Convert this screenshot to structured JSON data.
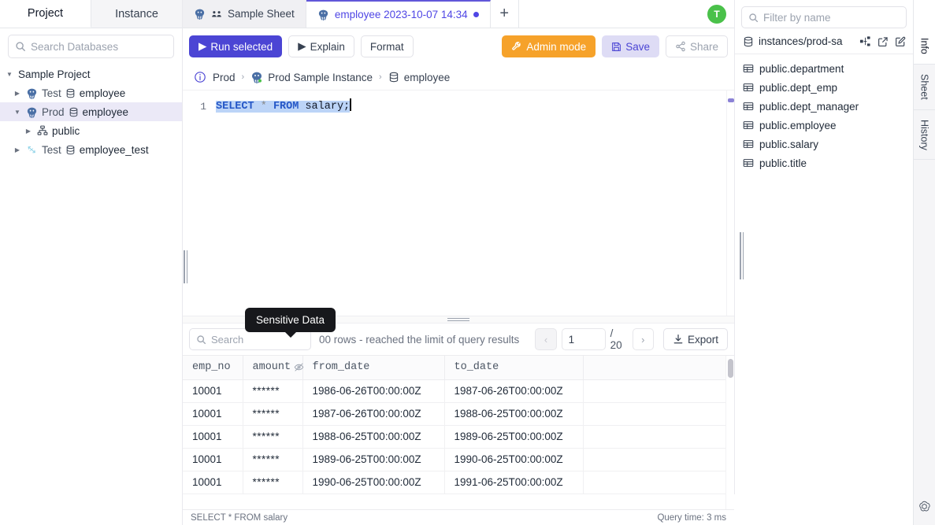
{
  "left_sidebar": {
    "tabs": [
      {
        "label": "Project",
        "active": true
      },
      {
        "label": "Instance",
        "active": false
      }
    ],
    "search": {
      "placeholder": "Search Databases",
      "value": ""
    },
    "tree": [
      {
        "label": "Sample Project",
        "icon": "none",
        "caret": "down",
        "level": 0,
        "selected": false
      },
      {
        "label_prefix": "Test",
        "label": "employee",
        "icon": "postgres-icon",
        "db_icon": "database-icon",
        "caret": "right",
        "level": 1,
        "selected": false
      },
      {
        "label_prefix": "Prod",
        "label": "employee",
        "icon": "postgres-icon",
        "db_icon": "database-icon",
        "caret": "down",
        "level": 1,
        "selected": true
      },
      {
        "label": "public",
        "icon": "schema-icon",
        "caret": "right",
        "level": 2,
        "selected": false
      },
      {
        "label_prefix": "Test",
        "label": "employee_test",
        "icon": "snowflake-icon",
        "db_icon": "database-icon",
        "caret": "right",
        "level": 1,
        "selected": false
      }
    ]
  },
  "tabbar": {
    "tabs": [
      {
        "label": "Sample Sheet",
        "icon": "postgres-icon",
        "secondary_icon": "people-icon",
        "active": false,
        "dirty": false
      },
      {
        "label": "employee 2023-10-07 14:34",
        "icon": "postgres-icon",
        "active": true,
        "dirty": true
      }
    ],
    "add_label": "+",
    "avatar_initial": "T"
  },
  "toolbar": {
    "run_label": "Run selected",
    "explain_label": "Explain",
    "format_label": "Format",
    "admin_label": "Admin mode",
    "save_label": "Save",
    "share_label": "Share",
    "colors": {
      "run_bg": "#4b45d4",
      "admin_bg": "#f6a22a",
      "save_bg": "#dedcf5",
      "save_fg": "#4b45d4"
    }
  },
  "breadcrumb": {
    "environment": "Prod",
    "instance": "Prod Sample Instance",
    "database": "employee",
    "separator": "›"
  },
  "editor": {
    "line_number": "1",
    "code": {
      "keyword1": "SELECT",
      "star": "*",
      "keyword2": "FROM",
      "table": "salary;"
    },
    "full_text": "SELECT * FROM salary;"
  },
  "results": {
    "search": {
      "placeholder": "Search",
      "value": ""
    },
    "info_text": "00 rows  -  reached the limit of query results",
    "pager": {
      "prev_label": "‹",
      "next_label": "›",
      "current_page": "1",
      "total_pages": "/ 20"
    },
    "export_label": "Export",
    "tooltip": "Sensitive Data",
    "columns": [
      "emp_no",
      "amount",
      "from_date",
      "to_date",
      ""
    ],
    "sensitive_column": "amount",
    "rows": [
      [
        "10001",
        "******",
        "1986-06-26T00:00:00Z",
        "1987-06-26T00:00:00Z",
        ""
      ],
      [
        "10001",
        "******",
        "1987-06-26T00:00:00Z",
        "1988-06-25T00:00:00Z",
        ""
      ],
      [
        "10001",
        "******",
        "1988-06-25T00:00:00Z",
        "1989-06-25T00:00:00Z",
        ""
      ],
      [
        "10001",
        "******",
        "1989-06-25T00:00:00Z",
        "1990-06-25T00:00:00Z",
        ""
      ],
      [
        "10001",
        "******",
        "1990-06-25T00:00:00Z",
        "1991-06-25T00:00:00Z",
        ""
      ]
    ]
  },
  "statusbar": {
    "query": "SELECT * FROM salary",
    "query_time": "Query time: 3 ms"
  },
  "right_panel": {
    "search": {
      "placeholder": "Filter by name",
      "value": ""
    },
    "instance": "instances/prod-sa",
    "instance_actions": [
      "sync-icon",
      "external-link-icon",
      "edit-icon"
    ],
    "tables": [
      "public.department",
      "public.dept_emp",
      "public.dept_manager",
      "public.employee",
      "public.salary",
      "public.title"
    ]
  },
  "rail": {
    "tabs": [
      {
        "label": "Info",
        "active": true
      },
      {
        "label": "Sheet",
        "active": false
      },
      {
        "label": "History",
        "active": false
      }
    ],
    "logo": "openai-logo-icon"
  }
}
